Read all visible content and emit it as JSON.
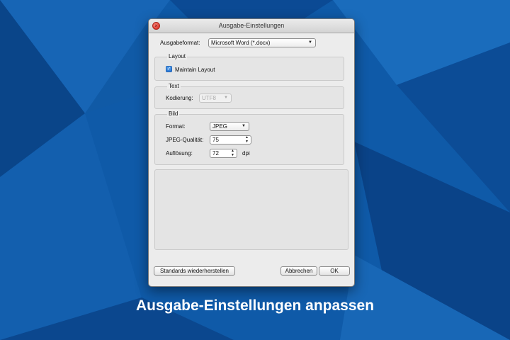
{
  "dialog": {
    "title": "Ausgabe-Einstellungen",
    "output_format_label": "Ausgabeformat:",
    "output_format_value": "Microsoft Word (*.docx)"
  },
  "layout_group": {
    "title": "Layout",
    "maintain_layout_label": "Maintain Layout",
    "maintain_layout_checked": true
  },
  "text_group": {
    "title": "Text",
    "encoding_label": "Kodierung:",
    "encoding_value": "UTF8"
  },
  "image_group": {
    "title": "Bild",
    "format_label": "Format:",
    "format_value": "JPEG",
    "quality_label": "JPEG-Qualität:",
    "quality_value": "75",
    "resolution_label": "Auflösung:",
    "resolution_value": "72",
    "resolution_unit": "dpi"
  },
  "buttons": {
    "restore_defaults": "Standards wiederherstellen",
    "cancel": "Abbrechen",
    "ok": "OK"
  },
  "caption": "Ausgabe-Einstellungen anpassen",
  "colors": {
    "background": "#0d4f9a",
    "accent": "#2a78d6",
    "close_button": "#e0372c"
  }
}
